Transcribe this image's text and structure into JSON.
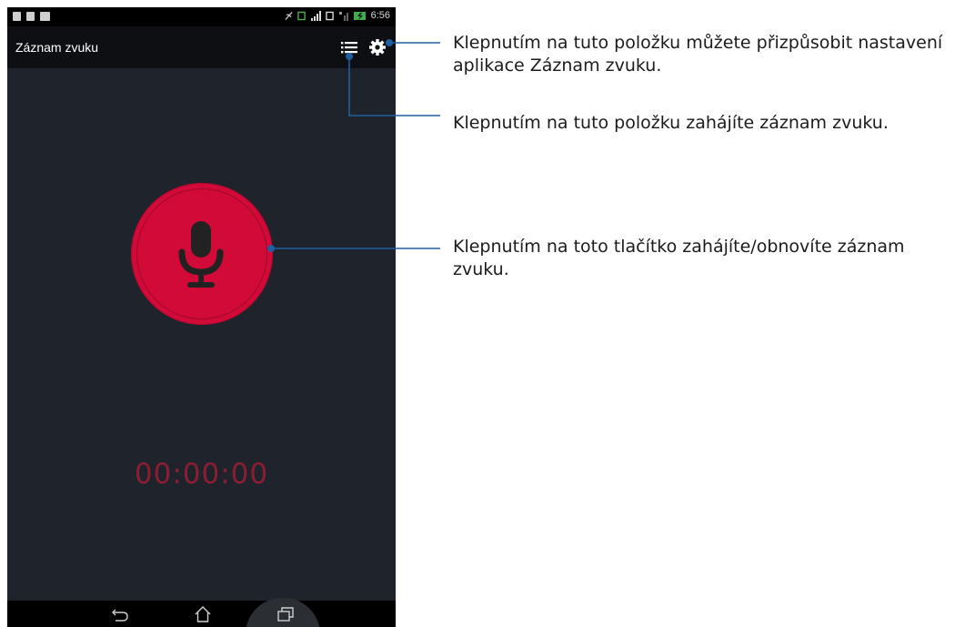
{
  "app": {
    "title": "Záznam zvuku",
    "timer": "00:00:00"
  },
  "status_bar": {
    "time": "6:56"
  },
  "icons": {
    "list": "list-icon",
    "settings": "gear-icon",
    "microphone": "microphone-icon",
    "back": "back-icon",
    "home": "home-icon",
    "recents": "recents-icon"
  },
  "callouts": {
    "settings": "Klepnutím na tuto položku můžete přizpůsobit nastavení aplikace Záznam zvuku.",
    "list": "Klepnutím na tuto položku zahájíte záznam zvuku.",
    "record": "Klepnutím na toto tlačítko zahájíte/obnovíte záznam zvuku."
  },
  "colors": {
    "record_button": "#d10a37",
    "timer": "#8c1e33",
    "callout_line": "#1f5fa0"
  }
}
